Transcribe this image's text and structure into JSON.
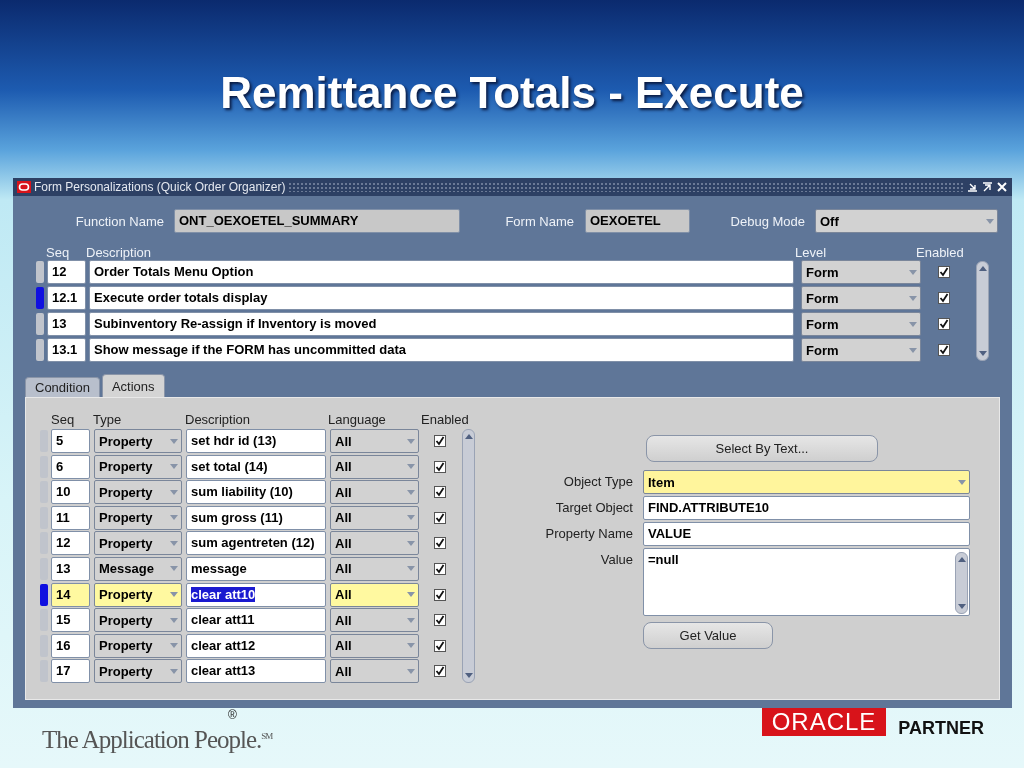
{
  "slide_title": "Remittance Totals - Execute",
  "window": {
    "title": "Form Personalizations (Quick Order Organizer)"
  },
  "header": {
    "function_name_label": "Function Name",
    "function_name": "ONT_OEXOETEL_SUMMARY",
    "form_name_label": "Form Name",
    "form_name": "OEXOETEL",
    "debug_mode_label": "Debug Mode",
    "debug_mode": "Off"
  },
  "rules": {
    "columns": [
      "Seq",
      "Description",
      "Level",
      "Enabled"
    ],
    "rows": [
      {
        "seq": "12",
        "description": "Order Totals Menu Option",
        "level": "Form",
        "enabled": true,
        "selected": false
      },
      {
        "seq": "12.1",
        "description": "Execute order totals display",
        "level": "Form",
        "enabled": true,
        "selected": true
      },
      {
        "seq": "13",
        "description": "Subinventory Re-assign if Inventory is  moved",
        "level": "Form",
        "enabled": true,
        "selected": false
      },
      {
        "seq": "13.1",
        "description": "Show message if the FORM has uncommitted data",
        "level": "Form",
        "enabled": true,
        "selected": false
      }
    ]
  },
  "tabs": [
    {
      "label": "Condition",
      "selected": false
    },
    {
      "label": "Actions",
      "selected": true
    }
  ],
  "actions": {
    "columns": [
      "Seq",
      "Type",
      "Description",
      "Language",
      "Enabled"
    ],
    "rows": [
      {
        "seq": "5",
        "type": "Property",
        "description": "set hdr id (13)",
        "language": "All",
        "enabled": true,
        "selected": false
      },
      {
        "seq": "6",
        "type": "Property",
        "description": "set total (14)",
        "language": "All",
        "enabled": true,
        "selected": false
      },
      {
        "seq": "10",
        "type": "Property",
        "description": "sum liability (10)",
        "language": "All",
        "enabled": true,
        "selected": false
      },
      {
        "seq": "11",
        "type": "Property",
        "description": "sum gross (11)",
        "language": "All",
        "enabled": true,
        "selected": false
      },
      {
        "seq": "12",
        "type": "Property",
        "description": "sum agentreten (12)",
        "language": "All",
        "enabled": true,
        "selected": false
      },
      {
        "seq": "13",
        "type": "Message",
        "description": "message",
        "language": "All",
        "enabled": true,
        "selected": false
      },
      {
        "seq": "14",
        "type": "Property",
        "description": "clear att10",
        "language": "All",
        "enabled": true,
        "selected": true
      },
      {
        "seq": "15",
        "type": "Property",
        "description": "clear att11",
        "language": "All",
        "enabled": true,
        "selected": false
      },
      {
        "seq": "16",
        "type": "Property",
        "description": "clear att12",
        "language": "All",
        "enabled": true,
        "selected": false
      },
      {
        "seq": "17",
        "type": "Property",
        "description": "clear att13",
        "language": "All",
        "enabled": true,
        "selected": false
      }
    ]
  },
  "action_detail": {
    "select_button": "Select By Text...",
    "fields": [
      {
        "label": "Object Type",
        "value": "Item",
        "kind": "dropdown"
      },
      {
        "label": "Target Object",
        "value": "FIND.ATTRIBUTE10",
        "kind": "text"
      },
      {
        "label": "Property Name",
        "value": "VALUE",
        "kind": "text"
      },
      {
        "label": "Value",
        "value": "=null",
        "kind": "textarea"
      }
    ],
    "get_value_button": "Get Value"
  },
  "footer": {
    "registered_mark": "®",
    "tagline": "The Application People.$^{SM}$",
    "partner_logo": "ORACLE",
    "partner_text": "PARTNER"
  }
}
